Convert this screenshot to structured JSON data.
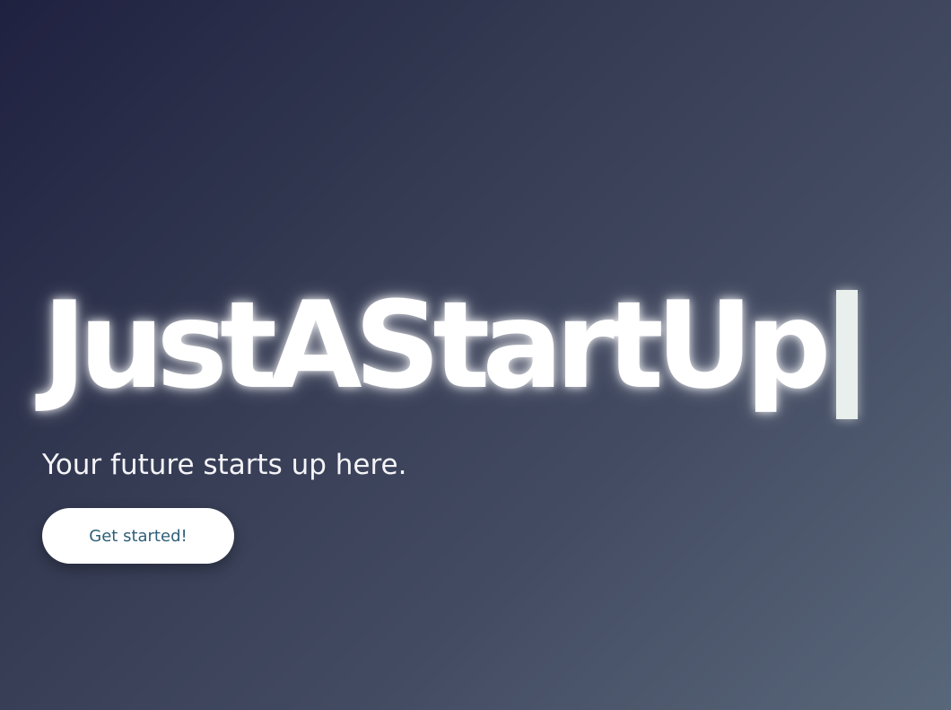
{
  "hero": {
    "headline": "JustAStartUp",
    "tagline": "Your future starts up here.",
    "cta_label": "Get started!"
  },
  "colors": {
    "background_start": "#1f2140",
    "background_end": "#59677a",
    "headline": "#ffffff",
    "cursor": "#e8efec",
    "button_background": "#ffffff",
    "button_text": "#2e5f78"
  }
}
